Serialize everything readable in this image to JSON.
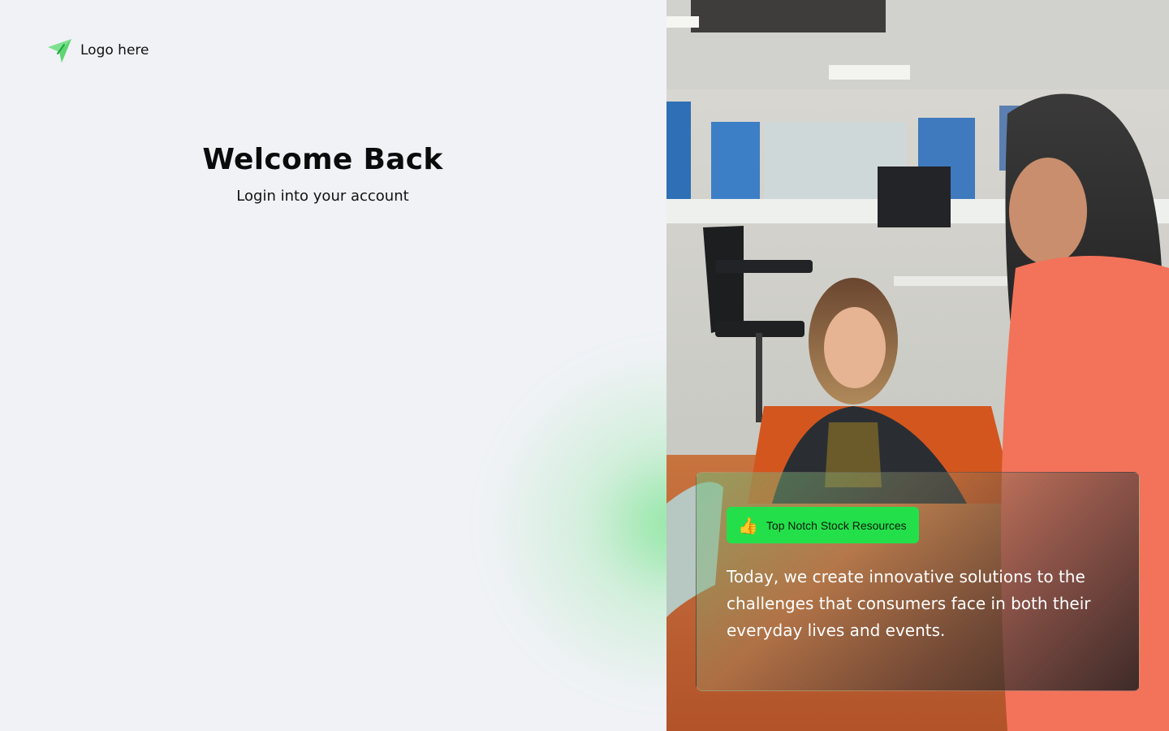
{
  "brand": {
    "logo_text": "Logo here",
    "logo_icon": "paper-plane-icon",
    "accent_color": "#23e04a"
  },
  "login": {
    "title": "Welcome Back",
    "subtitle": "Login into your account"
  },
  "hero": {
    "image": "two-women-office-laptop-photo",
    "badge_icon": "thumbs-up-icon",
    "badge_label": "Top Notch Stock Resources",
    "quote": "Today, we create innovative solutions to the challenges that consumers face in both their everyday lives and events."
  }
}
